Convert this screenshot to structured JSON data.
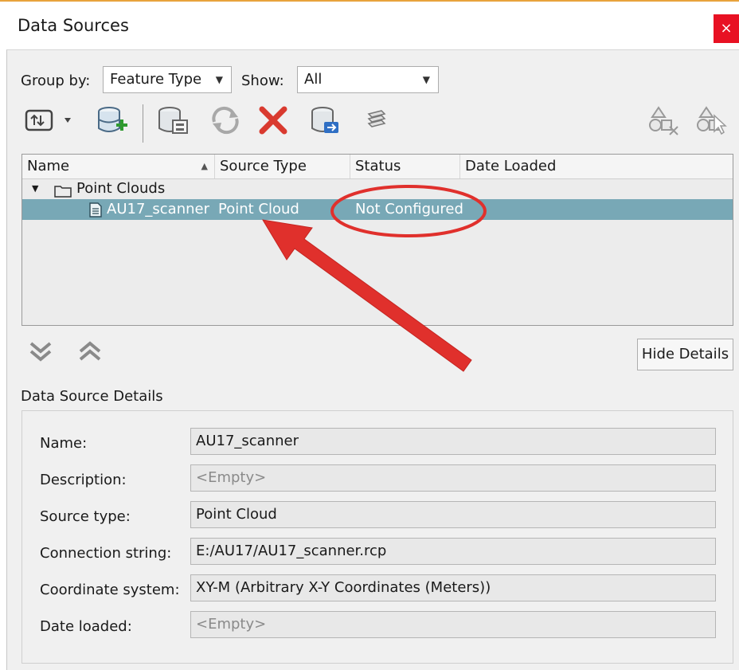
{
  "window": {
    "title": "Data Sources",
    "close_label": "×"
  },
  "toolbar": {
    "group_by_label": "Group by:",
    "group_by_value": "Feature Type",
    "show_label": "Show:",
    "show_value": "All",
    "icons": [
      "attach-icon",
      "add-data-source-icon",
      "properties-icon",
      "refresh-icon",
      "remove-icon",
      "load-icon",
      "edit-icon",
      "filter-shape-icon",
      "select-shape-icon"
    ]
  },
  "grid": {
    "columns": [
      "Name",
      "Source Type",
      "Status",
      "Date Loaded"
    ],
    "group": {
      "label": "Point Clouds"
    },
    "rows": [
      {
        "name": "AU17_scanner",
        "source_type": "Point Cloud",
        "status": "Not Configured",
        "date_loaded": ""
      }
    ]
  },
  "buttons": {
    "hide_details": "Hide Details"
  },
  "details": {
    "heading": "Data Source Details",
    "fields": [
      {
        "label": "Name:",
        "value": "AU17_scanner"
      },
      {
        "label": "Description:",
        "value": "<Empty>"
      },
      {
        "label": "Source type:",
        "value": "Point Cloud"
      },
      {
        "label": "Connection string:",
        "value": "E:/AU17/AU17_scanner.rcp"
      },
      {
        "label": "Coordinate system:",
        "value": "XY-M (Arbitrary X-Y Coordinates (Meters))"
      },
      {
        "label": "Date loaded:",
        "value": "<Empty>"
      }
    ]
  },
  "colors": {
    "selection": "#78a8b6",
    "annotation_red": "#e0302c",
    "close_red": "#e81123",
    "title_accent": "#e8a33c"
  }
}
